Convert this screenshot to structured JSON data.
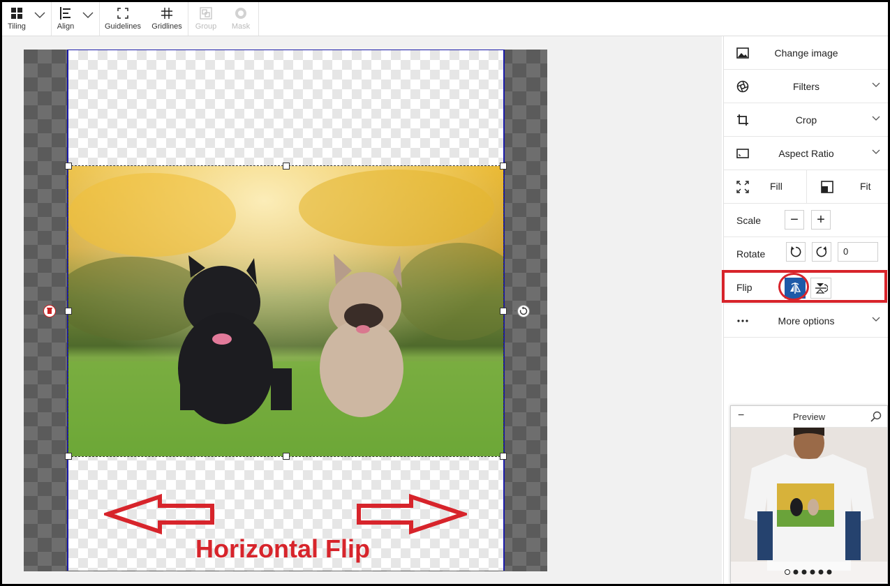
{
  "toolbar": {
    "tiling": "Tiling",
    "align": "Align",
    "guidelines": "Guidelines",
    "gridlines": "Gridlines",
    "group": "Group",
    "mask": "Mask"
  },
  "canvas": {
    "annotation": "Horizontal Flip",
    "annotation_color": "#d7242b"
  },
  "panel": {
    "change_image": "Change image",
    "filters": "Filters",
    "crop": "Crop",
    "aspect_ratio": "Aspect Ratio",
    "fill": "Fill",
    "fit": "Fit",
    "scale": "Scale",
    "scale_minus": "−",
    "scale_plus": "+",
    "rotate": "Rotate",
    "rotate_value": "0",
    "flip": "Flip",
    "more_options": "More options"
  },
  "preview": {
    "title": "Preview",
    "collapse": "−",
    "active_dot": 0,
    "dot_count": 6
  },
  "colors": {
    "accent_blue": "#1e5aa8",
    "highlight_red": "#d7242b"
  }
}
